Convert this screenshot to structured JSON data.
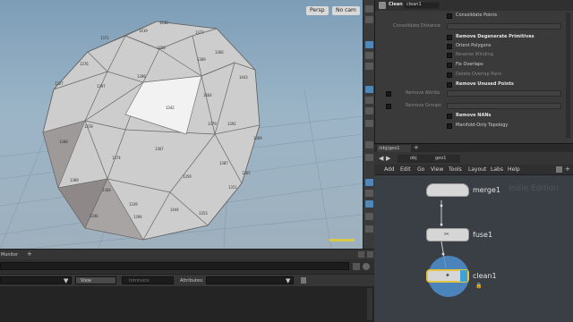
{
  "viewport": {
    "camera_dropdown": "Persp",
    "cam_dropdown": "No cam",
    "face_numbers": [
      "1436",
      "1371",
      "1419",
      "1377",
      "1450",
      "1389",
      "1366",
      "1376",
      "1397",
      "1398",
      "1464",
      "1443",
      "1327",
      "1342",
      "1392",
      "1378",
      "1300",
      "1369",
      "1367",
      "1374",
      "1387",
      "1365",
      "1359",
      "1389",
      "1368",
      "1394",
      "1444",
      "1353",
      "1346",
      "1351",
      "1339",
      "1379"
    ]
  },
  "parameters": {
    "node_type": "Clean",
    "node_name": "clean1",
    "rows": [
      {
        "label": "Consolidate Points",
        "checked": false,
        "style": "normal"
      },
      {
        "label": "Consolidate Distance",
        "style": "dim-field"
      },
      {
        "label": "Remove Degenerate Primitives",
        "checked": false,
        "style": "bold"
      },
      {
        "label": "Orient Polygons",
        "checked": false,
        "style": "normal"
      },
      {
        "label": "Reverse Winding",
        "checked": false,
        "style": "dim"
      },
      {
        "label": "Fix Overlaps",
        "checked": false,
        "style": "normal"
      },
      {
        "label": "Delete Overlap Pairs",
        "checked": false,
        "style": "dim"
      },
      {
        "label": "Remove Unused Points",
        "checked": false,
        "style": "bold"
      },
      {
        "label": "Remove Attribs",
        "style": "dim-field"
      },
      {
        "label": "Remove Groups",
        "style": "dim-field"
      },
      {
        "label": "Remove NANs",
        "checked": false,
        "style": "bold"
      },
      {
        "label": "Manifold-Only Topology",
        "checked": false,
        "style": "normal"
      }
    ]
  },
  "lower": {
    "tab_label": "Monitor",
    "view_label": "View",
    "intrinsics_label": "Intrinsics",
    "attributes_label": "Attributes:"
  },
  "network": {
    "tab_label": "/obj/geo1",
    "path": [
      "obj",
      "geo1"
    ],
    "menu": [
      "Add",
      "Edit",
      "Go",
      "View",
      "Tools",
      "Layout",
      "Labs",
      "Help"
    ],
    "watermark": "Indie Edition",
    "nodes": [
      {
        "name": "merge1"
      },
      {
        "name": "fuse1"
      },
      {
        "name": "clean1"
      }
    ]
  },
  "colors": {
    "accent": "#4e87b8",
    "selected_node_halo": "#4f8fd0",
    "viewport_sky": "#8fabc2"
  }
}
